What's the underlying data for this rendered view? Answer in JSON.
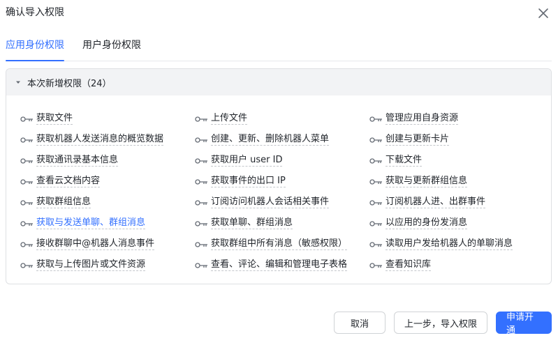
{
  "dialog": {
    "title": "确认导入权限"
  },
  "tabs": [
    {
      "label": "应用身份权限",
      "active": true
    },
    {
      "label": "用户身份权限",
      "active": false
    }
  ],
  "panel": {
    "header": "本次新增权限（24）"
  },
  "permissions": [
    {
      "label": "获取文件"
    },
    {
      "label": "上传文件"
    },
    {
      "label": "管理应用自身资源"
    },
    {
      "label": "获取机器人发送消息的概览数据"
    },
    {
      "label": "创建、更新、删除机器人菜单"
    },
    {
      "label": "创建与更新卡片"
    },
    {
      "label": "获取通讯录基本信息"
    },
    {
      "label": "获取用户 user ID"
    },
    {
      "label": "下载文件"
    },
    {
      "label": "查看云文档内容"
    },
    {
      "label": "获取事件的出口 IP"
    },
    {
      "label": "获取与更新群组信息"
    },
    {
      "label": "获取群组信息"
    },
    {
      "label": "订阅访问机器人会话相关事件"
    },
    {
      "label": "订阅机器人进、出群事件"
    },
    {
      "label": "获取与发送单聊、群组消息",
      "highlight": true
    },
    {
      "label": "获取单聊、群组消息"
    },
    {
      "label": "以应用的身份发消息"
    },
    {
      "label": "接收群聊中@机器人消息事件"
    },
    {
      "label": "获取群组中所有消息（敏感权限）"
    },
    {
      "label": "读取用户发给机器人的单聊消息"
    },
    {
      "label": "获取与上传图片或文件资源"
    },
    {
      "label": "查看、评论、编辑和管理电子表格"
    },
    {
      "label": "查看知识库"
    }
  ],
  "footer": {
    "cancel_label": "取消",
    "back_label": "上一步，导入权限",
    "submit_label": "申请开通"
  },
  "colors": {
    "accent": "#3370ff",
    "border": "#dee0e3",
    "header_bg": "#f2f3f5"
  },
  "icons": {
    "close": "close-icon",
    "caret": "caret-down-icon",
    "key": "key-icon"
  }
}
